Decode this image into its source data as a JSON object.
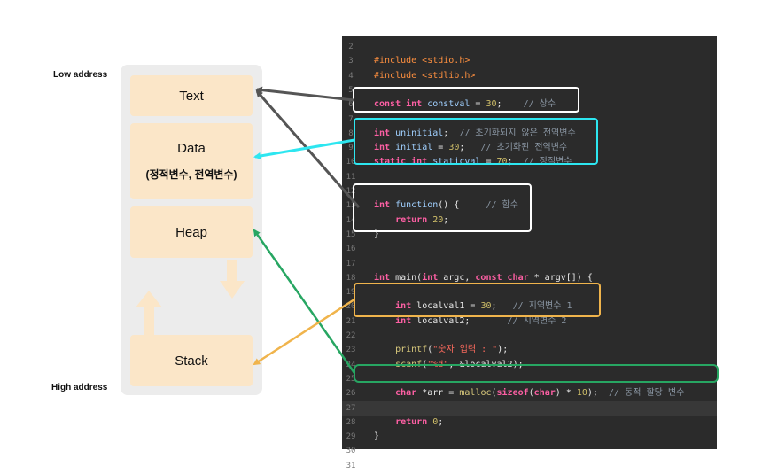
{
  "labels": {
    "low_address": "Low address",
    "high_address": "High address"
  },
  "memory": {
    "text": "Text",
    "data": "Data",
    "data_sub": "(정적변수, 전역변수)",
    "heap": "Heap",
    "stack": "Stack"
  },
  "code": {
    "lines": [
      {
        "n": "2",
        "html": ""
      },
      {
        "n": "3",
        "html": "<span class='pp'>#include &lt;stdio.h&gt;</span>"
      },
      {
        "n": "4",
        "html": "<span class='pp'>#include &lt;stdlib.h&gt;</span>"
      },
      {
        "n": "5",
        "html": ""
      },
      {
        "n": "6",
        "html": "<span class='kw'>const int</span> <span class='var'>constval</span> = <span class='num'>30</span>;    <span class='cmt'>// 상수</span>"
      },
      {
        "n": "7",
        "html": ""
      },
      {
        "n": "8",
        "html": "<span class='kw'>int</span> <span class='var'>uninitial</span>;  <span class='cmt'>// 초기화되지 않은 전역변수</span>"
      },
      {
        "n": "9",
        "html": "<span class='kw'>int</span> <span class='var'>initial</span> = <span class='num'>30</span>;   <span class='cmt'>// 초기화된 전역변수</span>"
      },
      {
        "n": "10",
        "html": "<span class='kw'>static int</span> <span class='var'>staticval</span> = <span class='num'>70</span>;  <span class='cmt'>// 정적변수</span>"
      },
      {
        "n": "11",
        "html": ""
      },
      {
        "n": "12",
        "html": ""
      },
      {
        "n": "13",
        "html": "<span class='kw'>int</span> <span class='var'>function</span>() {     <span class='cmt'>// 함수</span>"
      },
      {
        "n": "14",
        "html": "    <span class='kw'>return</span> <span class='num'>20</span>;"
      },
      {
        "n": "15",
        "html": "}"
      },
      {
        "n": "16",
        "html": ""
      },
      {
        "n": "17",
        "html": ""
      },
      {
        "n": "18",
        "html": "<span class='kw'>int</span> main(<span class='kw'>int</span> argc, <span class='kw'>const char</span> * argv[]) {"
      },
      {
        "n": "19",
        "html": ""
      },
      {
        "n": "20",
        "html": "    <span class='kw'>int</span> localval1 = <span class='num'>30</span>;   <span class='cmt'>// 지역변수 1</span>"
      },
      {
        "n": "21",
        "html": "    <span class='kw'>int</span> localval2;       <span class='cmt'>// 지역변수 2</span>"
      },
      {
        "n": "22",
        "html": ""
      },
      {
        "n": "23",
        "html": "    <span class='fn'>printf</span>(<span class='str'>\"숫자 입력 : \"</span>);"
      },
      {
        "n": "24",
        "html": "    <span class='fn'>scanf</span>(<span class='str'>\"%d\"</span>, &amp;localval2);"
      },
      {
        "n": "25",
        "html": ""
      },
      {
        "n": "26",
        "html": "    <span class='kw'>char</span> *arr = <span class='fn'>malloc</span>(<span class='kw'>sizeof</span>(<span class='kw'>char</span>) * <span class='num'>10</span>);  <span class='cmt'>// 동적 할당 변수</span>"
      },
      {
        "n": "27",
        "html": "",
        "current": true
      },
      {
        "n": "28",
        "html": "    <span class='kw'>return</span> <span class='num'>0</span>;"
      },
      {
        "n": "29",
        "html": "}"
      },
      {
        "n": "30",
        "html": ""
      },
      {
        "n": "31",
        "html": ""
      }
    ]
  },
  "colors": {
    "text_arrow": "#555555",
    "data_arrow": "#2de6f0",
    "heap_arrow": "#27a662",
    "stack_arrow": "#f0b44c"
  }
}
